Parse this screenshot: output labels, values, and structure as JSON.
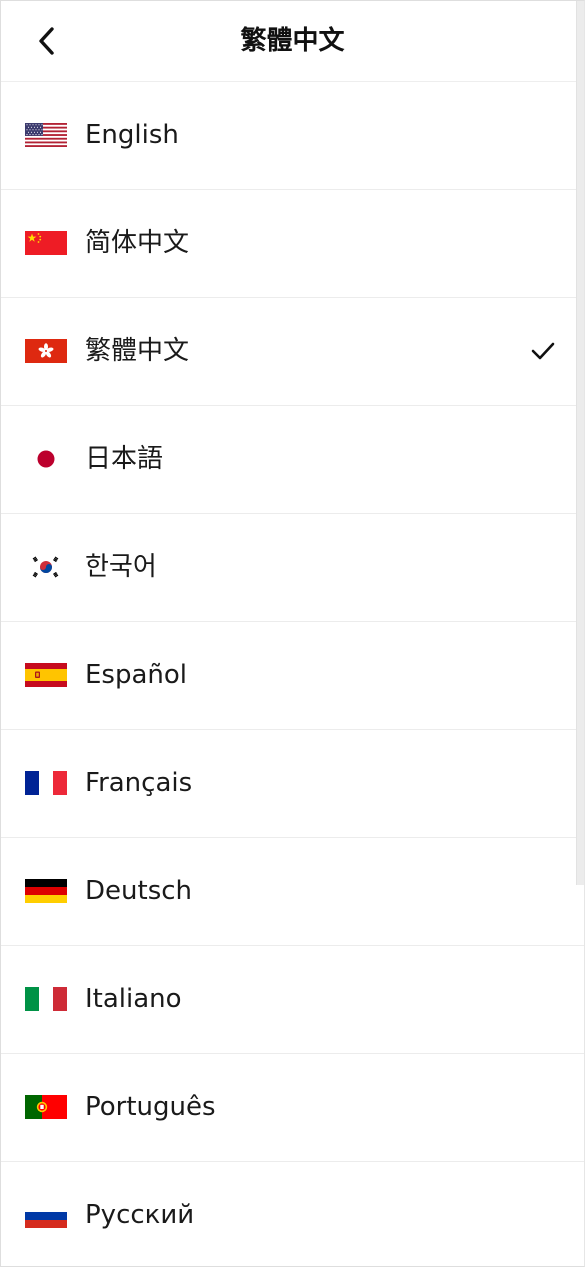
{
  "header": {
    "title": "繁體中文",
    "back_icon": "chevron-left-icon"
  },
  "languages": [
    {
      "label": "English",
      "flag": "us-flag-icon",
      "selected": false
    },
    {
      "label": "简体中文",
      "flag": "cn-flag-icon",
      "selected": false
    },
    {
      "label": "繁體中文",
      "flag": "hk-flag-icon",
      "selected": true
    },
    {
      "label": "日本語",
      "flag": "jp-flag-icon",
      "selected": false
    },
    {
      "label": "한국어",
      "flag": "kr-flag-icon",
      "selected": false
    },
    {
      "label": "Español",
      "flag": "es-flag-icon",
      "selected": false
    },
    {
      "label": "Français",
      "flag": "fr-flag-icon",
      "selected": false
    },
    {
      "label": "Deutsch",
      "flag": "de-flag-icon",
      "selected": false
    },
    {
      "label": "Italiano",
      "flag": "it-flag-icon",
      "selected": false
    },
    {
      "label": "Português",
      "flag": "pt-flag-icon",
      "selected": false
    },
    {
      "label": "Русский",
      "flag": "ru-flag-icon",
      "selected": false
    }
  ],
  "selected_icon": "checkmark-icon",
  "colors": {
    "text": "#1a1a1a",
    "divider": "#ececec",
    "background": "#ffffff"
  }
}
